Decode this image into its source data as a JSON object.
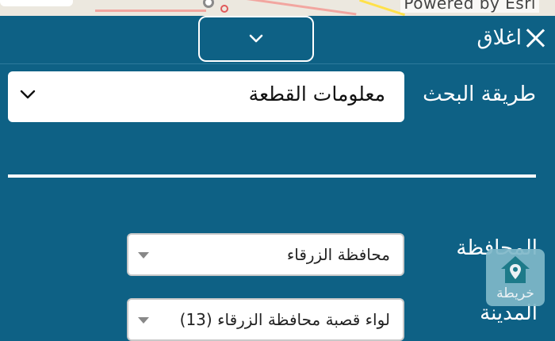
{
  "map": {
    "attribution": "Powered by Esri"
  },
  "header": {
    "close_label": "اغلاق",
    "collapse_icon": "chevron-down-icon"
  },
  "search": {
    "method_label": "طريقة البحث",
    "method_value": "معلومات القطعة"
  },
  "fields": [
    {
      "label": "المحافظة",
      "value": "محافظة الزرقاء"
    },
    {
      "label": "المدينة",
      "value": "لواء قصبة محافظة الزرقاء (13)"
    }
  ],
  "map_button": {
    "label": "خريطة",
    "icon": "map-home-pin-icon"
  },
  "colors": {
    "panel": "#0e6185",
    "map_button": "#7fb8c9"
  }
}
